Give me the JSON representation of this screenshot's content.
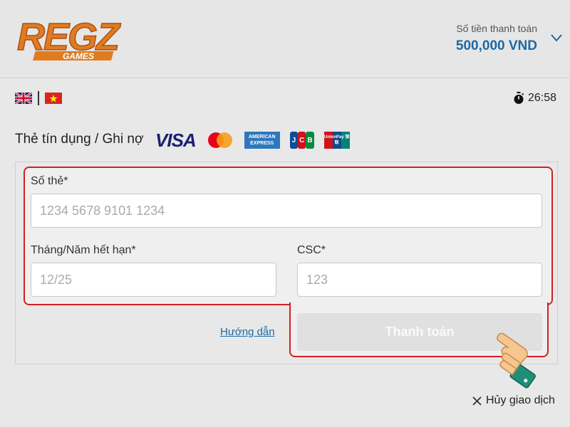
{
  "header": {
    "logo_text": "REGZ",
    "logo_sub": "GAMES",
    "amount_label": "Số tiền thanh toán",
    "amount_value": "500,000 VND",
    "expand_icon": "chevron-down-icon"
  },
  "lang_bar": {
    "languages": [
      {
        "name": "English",
        "icon": "uk-flag-icon"
      },
      {
        "name": "Tiếng Việt",
        "icon": "vn-flag-icon"
      }
    ],
    "timer_icon": "stopwatch-icon",
    "timer": "26:58"
  },
  "payment_method": {
    "title": "Thẻ tín dụng / Ghi nợ",
    "brands": {
      "visa": "VISA",
      "amex": "AMERICAN EXPRESS",
      "jcb": "JCB",
      "unionpay": "UnionPay 银联"
    }
  },
  "form": {
    "card_number_label": "Số thẻ*",
    "card_number_placeholder": "1234 5678 9101 1234",
    "expiry_label": "Tháng/Năm hết hạn*",
    "expiry_placeholder": "12/25",
    "csc_label": "CSC*",
    "csc_placeholder": "123",
    "guide_link": "Hướng dẫn",
    "pay_button": "Thanh toán"
  },
  "cancel": {
    "label": "Hủy giao dịch",
    "icon": "close-icon"
  },
  "colors": {
    "accent_blue": "#1b6aa5",
    "highlight_red": "#d31f26",
    "logo_orange": "#e07b1f"
  }
}
